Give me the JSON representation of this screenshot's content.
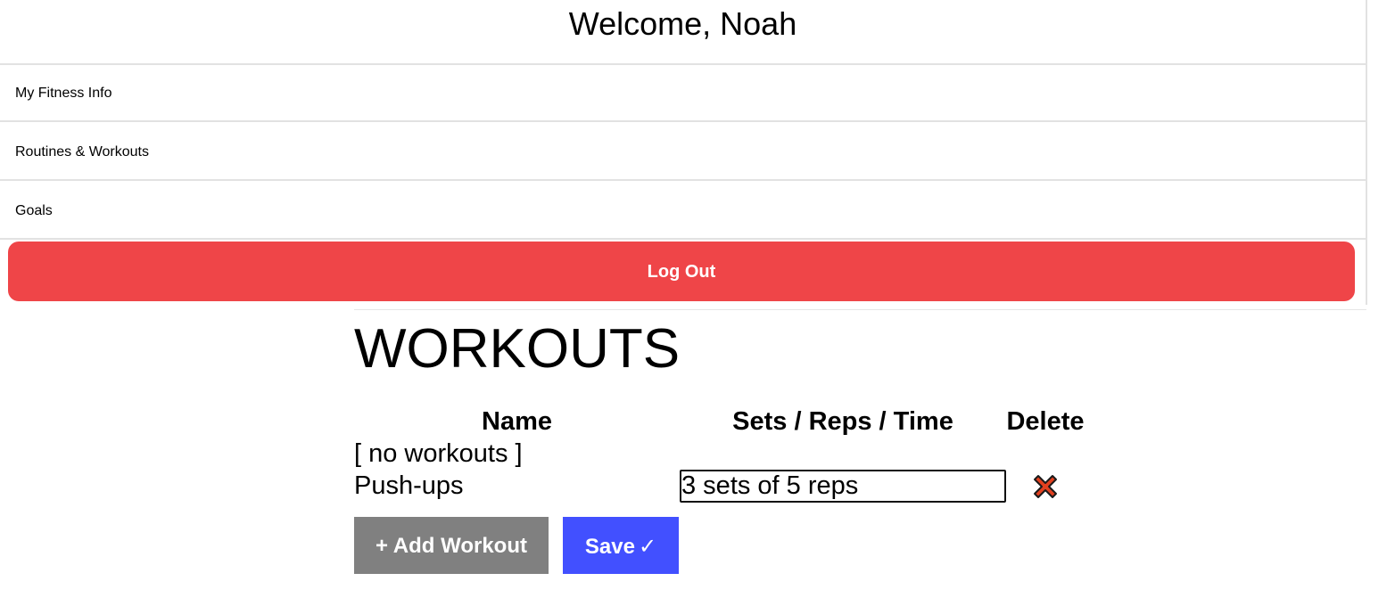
{
  "header": {
    "welcome_text": "Welcome, Noah"
  },
  "nav": {
    "items": [
      {
        "label": "My Fitness Info"
      },
      {
        "label": "Routines & Workouts"
      },
      {
        "label": "Goals"
      }
    ],
    "logout_label": "Log Out"
  },
  "workouts": {
    "title": "WORKOUTS",
    "columns": {
      "name": "Name",
      "sets": "Sets / Reps / Time",
      "delete": "Delete"
    },
    "empty_text": "[ no workouts ]",
    "rows": [
      {
        "name": "Push-ups",
        "sets_value": "3 sets of 5 reps",
        "delete_icon": "close-x-icon"
      }
    ],
    "add_label": "+ Add Workout",
    "save_label": "Save",
    "save_icon": "✓"
  },
  "colors": {
    "logout_bg": "#ef4548",
    "add_bg": "#808080",
    "save_bg": "#4250ff",
    "delete_icon": "#e2401f"
  }
}
